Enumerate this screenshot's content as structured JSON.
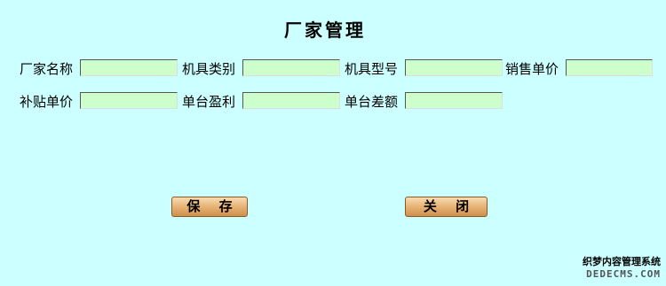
{
  "page": {
    "title": "厂家管理",
    "background_color": "#ccffff",
    "input_color": "#ccffcc"
  },
  "form": {
    "row1": [
      {
        "label": "厂家名称",
        "value": ""
      },
      {
        "label": "机具类别",
        "value": ""
      },
      {
        "label": "机具型号",
        "value": ""
      },
      {
        "label": "销售单价",
        "value": ""
      }
    ],
    "row2": [
      {
        "label": "补贴单价",
        "value": ""
      },
      {
        "label": "单台盈利",
        "value": ""
      },
      {
        "label": "单台差额",
        "value": ""
      }
    ]
  },
  "buttons": {
    "save_label": "保 存",
    "close_label": "关 闭"
  },
  "watermark": {
    "line1": "织梦内容管理系统",
    "line2": "DEDECMS.COM"
  }
}
